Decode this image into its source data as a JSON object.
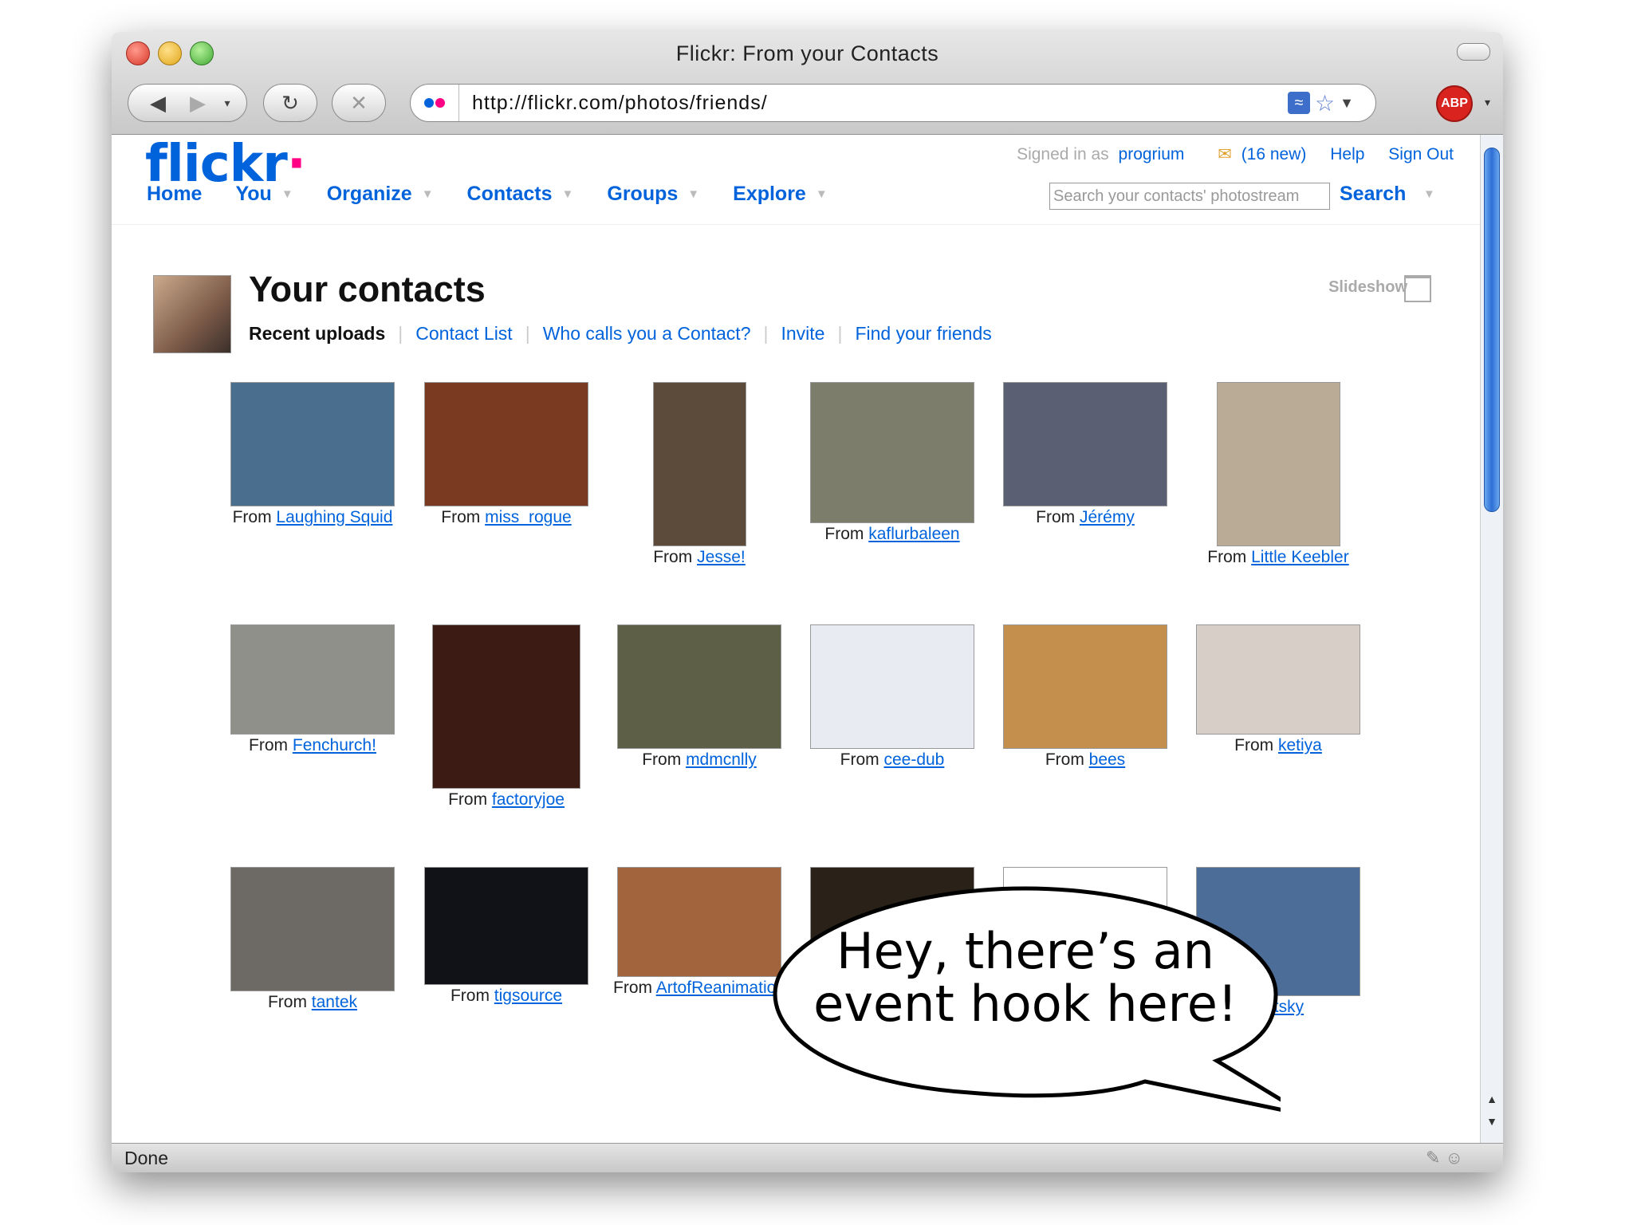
{
  "window": {
    "title": "Flickr: From your Contacts"
  },
  "browser": {
    "url": "http://flickr.com/photos/friends/",
    "abp_label": "ABP",
    "status": "Done"
  },
  "header": {
    "logo_main": "flickr",
    "logo_dot": "·",
    "signed_in_prefix": "Signed in as",
    "username": "progrium",
    "mail_count": "(16 new)",
    "help": "Help",
    "sign_out": "Sign Out"
  },
  "nav": {
    "items": [
      "Home",
      "You",
      "Organize",
      "Contacts",
      "Groups",
      "Explore"
    ],
    "search_placeholder": "Search your contacts' photostream",
    "search_label": "Search"
  },
  "page": {
    "title": "Your contacts",
    "tabs": [
      "Recent uploads",
      "Contact List",
      "Who calls you a Contact?",
      "Invite",
      "Find your friends"
    ],
    "slideshow": "Slideshow"
  },
  "photos": [
    {
      "from": "From",
      "user": "Laughing Squid",
      "color": "#4a6f8e"
    },
    {
      "from": "From",
      "user": "miss_rogue",
      "color": "#7a3a22"
    },
    {
      "from": "From",
      "user": "Jesse!",
      "color": "#5c4a3a"
    },
    {
      "from": "From",
      "user": "kaflurbaleen",
      "color": "#7c7d6b"
    },
    {
      "from": "From",
      "user": "Jérémy",
      "color": "#5a5f74"
    },
    {
      "from": "From",
      "user": "Little Keebler",
      "color": "#b9ab95"
    },
    {
      "from": "From",
      "user": "Fenchurch!",
      "color": "#8f9089"
    },
    {
      "from": "From",
      "user": "factoryjoe",
      "color": "#3b1b14"
    },
    {
      "from": "From",
      "user": "mdmcnlly",
      "color": "#5d6047"
    },
    {
      "from": "From",
      "user": "cee-dub",
      "color": "#e9ebf3"
    },
    {
      "from": "From",
      "user": "bees",
      "color": "#c48e4c"
    },
    {
      "from": "From",
      "user": "ketiya",
      "color": "#d7cfc7"
    },
    {
      "from": "From",
      "user": "tantek",
      "color": "#6d6a66"
    },
    {
      "from": "From",
      "user": "tigsource",
      "color": "#111118"
    },
    {
      "from": "From",
      "user": "ArtofReanimation",
      "color": "#a2643c"
    },
    {
      "from": "",
      "user": "",
      "color": "#2a2218"
    },
    {
      "from": "",
      "user": "",
      "color": "#ffffff"
    },
    {
      "from": "",
      "user": "slutsky",
      "color": "#4d6d99"
    }
  ],
  "callout": {
    "line1": "Hey, there’s an",
    "line2": "event hook here!"
  }
}
